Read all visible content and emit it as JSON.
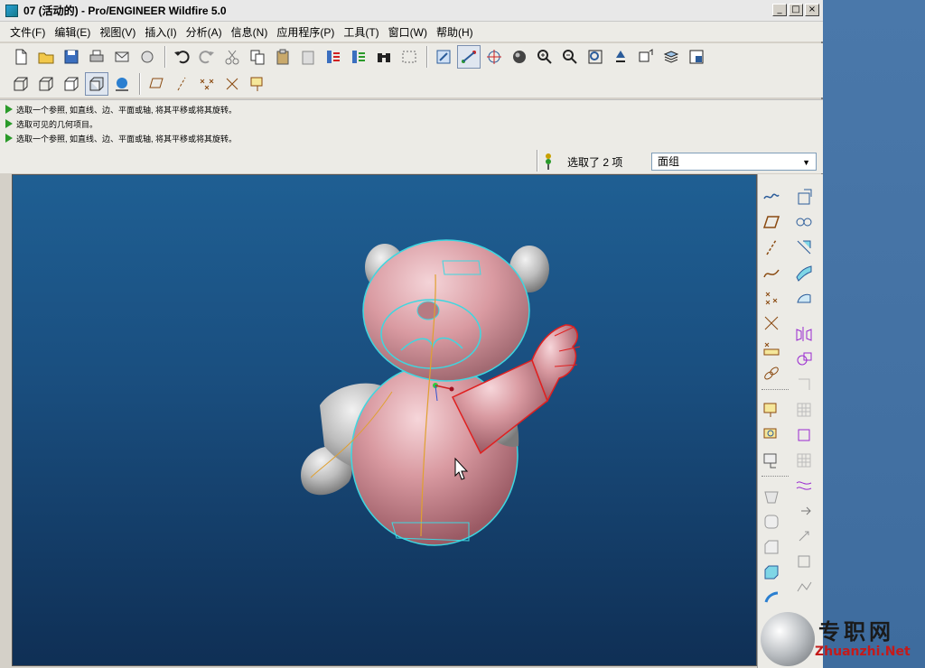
{
  "window": {
    "title": "07 (活动的) - Pro/ENGINEER Wildfire 5.0",
    "buttons": [
      "_",
      "□",
      "×"
    ]
  },
  "menubar": {
    "items": [
      "文件(F)",
      "编辑(E)",
      "视图(V)",
      "插入(I)",
      "分析(A)",
      "信息(N)",
      "应用程序(P)",
      "工具(T)",
      "窗口(W)",
      "帮助(H)"
    ]
  },
  "messages": [
    "选取一个参照, 如直线、边、平面或轴, 将其平移或将其旋转。",
    "选取可见的几何项目。",
    "选取一个参照, 如直线、边、平面或轴, 将其平移或将其旋转。"
  ],
  "status": {
    "selection_text": "选取了 2 项",
    "filter_value": "面组"
  },
  "watermark": {
    "text": "专职网",
    "subtext": "Zhuanzhi.Net"
  },
  "colors": {
    "viewport_top": "#1f5f93",
    "viewport_bottom": "#0f2f55",
    "selected_body": "#d89aa0",
    "highlight_edge": "#3ed7e0",
    "active_red": "#e02020"
  }
}
